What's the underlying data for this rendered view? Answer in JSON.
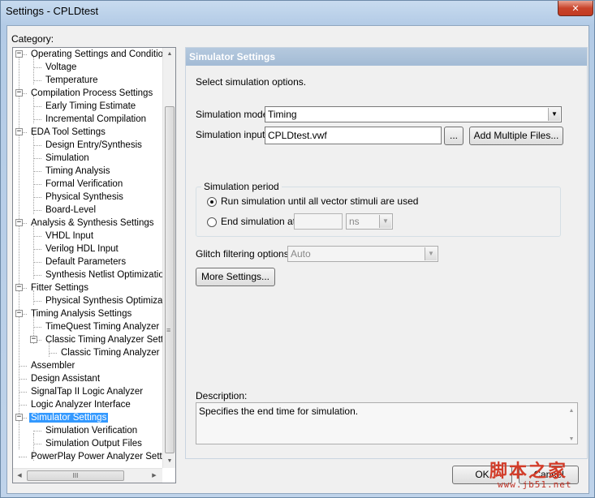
{
  "window": {
    "title": "Settings - CPLDtest",
    "close_glyph": "✕"
  },
  "category": {
    "label": "Category:",
    "tree": [
      {
        "label": "Operating Settings and Conditions",
        "level": 0,
        "expander": "−"
      },
      {
        "label": "Voltage",
        "level": 1
      },
      {
        "label": "Temperature",
        "level": 1
      },
      {
        "label": "Compilation Process Settings",
        "level": 0,
        "expander": "−"
      },
      {
        "label": "Early Timing Estimate",
        "level": 1
      },
      {
        "label": "Incremental Compilation",
        "level": 1
      },
      {
        "label": "EDA Tool Settings",
        "level": 0,
        "expander": "−"
      },
      {
        "label": "Design Entry/Synthesis",
        "level": 1
      },
      {
        "label": "Simulation",
        "level": 1
      },
      {
        "label": "Timing Analysis",
        "level": 1
      },
      {
        "label": "Formal Verification",
        "level": 1
      },
      {
        "label": "Physical Synthesis",
        "level": 1
      },
      {
        "label": "Board-Level",
        "level": 1
      },
      {
        "label": "Analysis & Synthesis Settings",
        "level": 0,
        "expander": "−"
      },
      {
        "label": "VHDL Input",
        "level": 1
      },
      {
        "label": "Verilog HDL Input",
        "level": 1
      },
      {
        "label": "Default Parameters",
        "level": 1
      },
      {
        "label": "Synthesis Netlist Optimizations",
        "level": 1
      },
      {
        "label": "Fitter Settings",
        "level": 0,
        "expander": "−"
      },
      {
        "label": "Physical Synthesis Optimizations",
        "level": 1
      },
      {
        "label": "Timing Analysis Settings",
        "level": 0,
        "expander": "−"
      },
      {
        "label": "TimeQuest Timing Analyzer",
        "level": 1
      },
      {
        "label": "Classic Timing Analyzer Settings",
        "level": 1,
        "expander": "−"
      },
      {
        "label": "Classic Timing Analyzer Reporting",
        "level": 2
      },
      {
        "label": "Assembler",
        "level": 0
      },
      {
        "label": "Design Assistant",
        "level": 0
      },
      {
        "label": "SignalTap II Logic Analyzer",
        "level": 0
      },
      {
        "label": "Logic Analyzer Interface",
        "level": 0
      },
      {
        "label": "Simulator Settings",
        "level": 0,
        "expander": "−",
        "selected": true
      },
      {
        "label": "Simulation Verification",
        "level": 1
      },
      {
        "label": "Simulation Output Files",
        "level": 1
      },
      {
        "label": "PowerPlay Power Analyzer Settings",
        "level": 0
      }
    ],
    "hscroll_grip": "III",
    "vscroll_grip": "≡"
  },
  "panel": {
    "header": "Simulator Settings",
    "intro": "Select simulation options.",
    "mode_label": "Simulation mode:",
    "mode_value": "Timing",
    "input_label": "Simulation input:",
    "input_value": "CPLDtest.vwf",
    "browse_label": "...",
    "add_files_label": "Add Multiple Files...",
    "period": {
      "title": "Simulation period",
      "run_all_label": "Run simulation until all vector stimuli are used",
      "end_at_label": "End simulation at:",
      "end_value": "",
      "unit_value": "ns",
      "selected": "run_all"
    },
    "glitch_label": "Glitch filtering options:",
    "glitch_value": "Auto",
    "more_settings_label": "More Settings...",
    "description_label": "Description:",
    "description_text": "Specifies the end time for simulation."
  },
  "footer": {
    "ok_label": "OK",
    "cancel_label": "Cancel"
  },
  "watermark": {
    "text": "脚本之家",
    "url": "www.jb51.net"
  }
}
